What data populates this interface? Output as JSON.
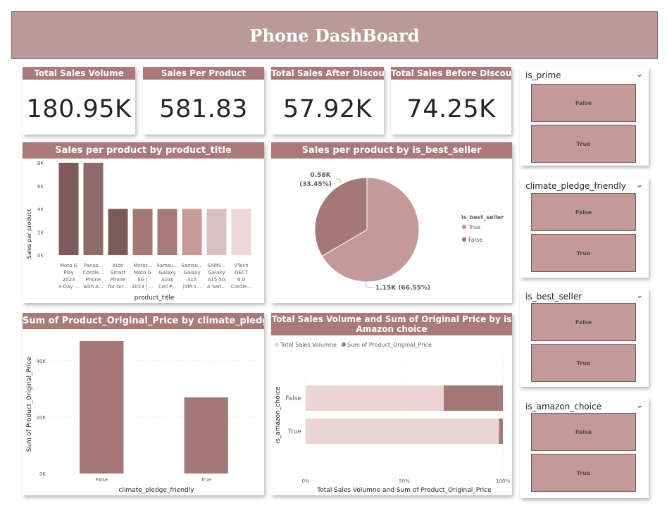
{
  "dashboard": {
    "title": "Phone DashBoard"
  },
  "kpis": [
    {
      "label": "Total Sales Volume",
      "value": "180.95K"
    },
    {
      "label": "Sales Per Product",
      "value": "581.83"
    },
    {
      "label": "Total Sales After Discount",
      "value": "57.92K"
    },
    {
      "label": "Total Sales Before Discount",
      "value": "74.25K"
    }
  ],
  "slicers": [
    {
      "title": "is_prime",
      "options": [
        "False",
        "True"
      ]
    },
    {
      "title": "climate_pledge_friendly",
      "options": [
        "False",
        "True"
      ]
    },
    {
      "title": "is_best_seller",
      "options": [
        "False",
        "True"
      ]
    },
    {
      "title": "is_amazon_choice",
      "options": [
        "False",
        "True"
      ]
    }
  ],
  "colors": {
    "accent": "#a97a79",
    "bars": [
      "#7e5b5a",
      "#8e6a6a",
      "#7b5b5a",
      "#a37877",
      "#a57a79",
      "#c79a99",
      "#d7c0bf",
      "#ebd8d7"
    ],
    "pie_true": "#c39a99",
    "pie_false": "#a37877",
    "stack_volume": "#ebd5d4",
    "stack_price": "#a37877"
  },
  "chart_data": [
    {
      "type": "bar",
      "title": "Sales per product by product_title",
      "xlabel": "product_title",
      "ylabel": "Sales per product",
      "ylim": [
        0,
        8000
      ],
      "yticks": [
        "0K",
        "2K",
        "4K",
        "6K",
        "8K"
      ],
      "categories": [
        [
          "Moto G",
          "Play",
          "2023",
          "3-Day ..."
        ],
        [
          "Panas...",
          "Cordle...",
          "Phone",
          "with A..."
        ],
        [
          "Kids",
          "Smart",
          "Phone",
          "for Gir..."
        ],
        [
          "Motor...",
          "Moto G",
          "5G |",
          "2023 | ..."
        ],
        [
          "Samsu...",
          "Galaxy",
          "A03s",
          "Cell P..."
        ],
        [
          "Samsu...",
          "Galaxy",
          "A15",
          "(SM-1..."
        ],
        [
          "SAMS...",
          "Galaxy",
          "A15 5G",
          "A Seri..."
        ],
        [
          "VTech",
          "DECT",
          "6.0",
          "Cordle..."
        ]
      ],
      "values": [
        8000,
        8000,
        4000,
        4000,
        4000,
        4000,
        4000,
        4000
      ]
    },
    {
      "type": "pie",
      "title": "Sales per product by is_best_seller",
      "legend_title": "is_best_seller",
      "legend_position": "right",
      "slices": [
        {
          "name": "True",
          "value": 1150,
          "label": "1.15K (66.55%)",
          "percent": 66.55
        },
        {
          "name": "False",
          "value": 580,
          "label": "0.58K (33.45%)",
          "percent": 33.45
        }
      ]
    },
    {
      "type": "bar",
      "title": "Sum of Product_Original_Price by climate_pledge_friendly",
      "xlabel": "climate_pledge_friendly",
      "ylabel": "Sum of Product_Original_Price",
      "ylim": [
        0,
        50000
      ],
      "yticks": [
        "0K",
        "20K",
        "40K"
      ],
      "categories": [
        "False",
        "True"
      ],
      "values": [
        47000,
        27000
      ]
    },
    {
      "type": "bar",
      "orientation": "horizontal-stacked-100",
      "title": "Total Sales Volume and Sum of Original Price by is Amazon choice",
      "xlabel": "Total Sales Volumne and Sum of Product_Original_Price",
      "ylabel": "is_amazon_choice",
      "legend_position": "top-left",
      "xticks": [
        "0%",
        "50%",
        "100%"
      ],
      "categories": [
        "False",
        "True"
      ],
      "series": [
        {
          "name": "Total Sales Volumne",
          "values": [
            70,
            98
          ]
        },
        {
          "name": "Sum of Product_Original_Price",
          "values": [
            30,
            2
          ]
        }
      ]
    }
  ]
}
